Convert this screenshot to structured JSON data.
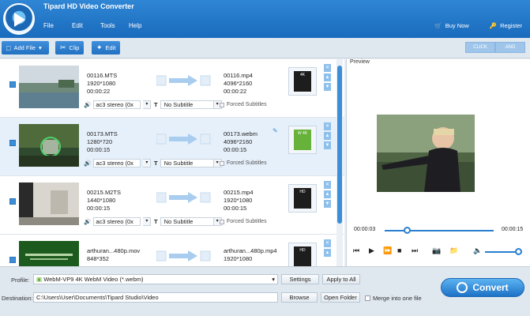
{
  "app": {
    "title": "Tipard HD Video Converter"
  },
  "menu": [
    "File",
    "Edit",
    "Tools",
    "Help"
  ],
  "top_right": {
    "buy": "Buy Now",
    "register": "Register"
  },
  "toolbar": {
    "add_file": "Add File",
    "clip": "Clip",
    "edit": "Edit",
    "clip_3d": "CLICK",
    "and": "AND"
  },
  "files": [
    {
      "src_name": "00116.MTS",
      "src_res": "1920*1080",
      "src_dur": "00:00:22",
      "dst_name": "00116.mp4",
      "dst_res": "4096*2160",
      "dst_dur": "00:00:22",
      "audio": "ac3 stereo (0x",
      "subtitle": "No Subtitle",
      "forced": "Forced Subtitles",
      "format_tag": "4K"
    },
    {
      "src_name": "00173.MTS",
      "src_res": "1280*720",
      "src_dur": "00:00:15",
      "dst_name": "00173.webm",
      "dst_res": "4096*2160",
      "dst_dur": "00:00:15",
      "audio": "ac3 stereo (0x",
      "subtitle": "No Subtitle",
      "forced": "Forced Subtitles",
      "format_tag": "W 4K"
    },
    {
      "src_name": "00215.M2TS",
      "src_res": "1440*1080",
      "src_dur": "00:00:15",
      "dst_name": "00215.mp4",
      "dst_res": "1920*1080",
      "dst_dur": "00:00:15",
      "audio": "ac3 stereo (0x",
      "subtitle": "No Subtitle",
      "forced": "Forced Subtitles",
      "format_tag": "HD"
    },
    {
      "src_name": "arthuran...480p.mov",
      "src_res": "848*352",
      "src_dur": "",
      "dst_name": "arthuran...480p.mp4",
      "dst_res": "1920*1080",
      "dst_dur": "",
      "audio": "",
      "subtitle": "",
      "forced": "",
      "format_tag": "HD"
    }
  ],
  "preview": {
    "label": "Preview",
    "time_current": "00:00:03",
    "time_total": "00:00:15"
  },
  "bottom": {
    "profile_label": "Profile:",
    "profile_value": "WebM-VP9 4K WebM Video (*.webm)",
    "settings": "Settings",
    "apply_all": "Apply to All",
    "dest_label": "Destination:",
    "dest_value": "C:\\Users\\User\\Documents\\Tipard Studio\\Video",
    "browse": "Browse",
    "open_folder": "Open Folder",
    "merge": "Merge into one file",
    "convert": "Convert"
  },
  "colors": {
    "accent": "#1a6bbd",
    "progress": "#2a7fd0"
  }
}
